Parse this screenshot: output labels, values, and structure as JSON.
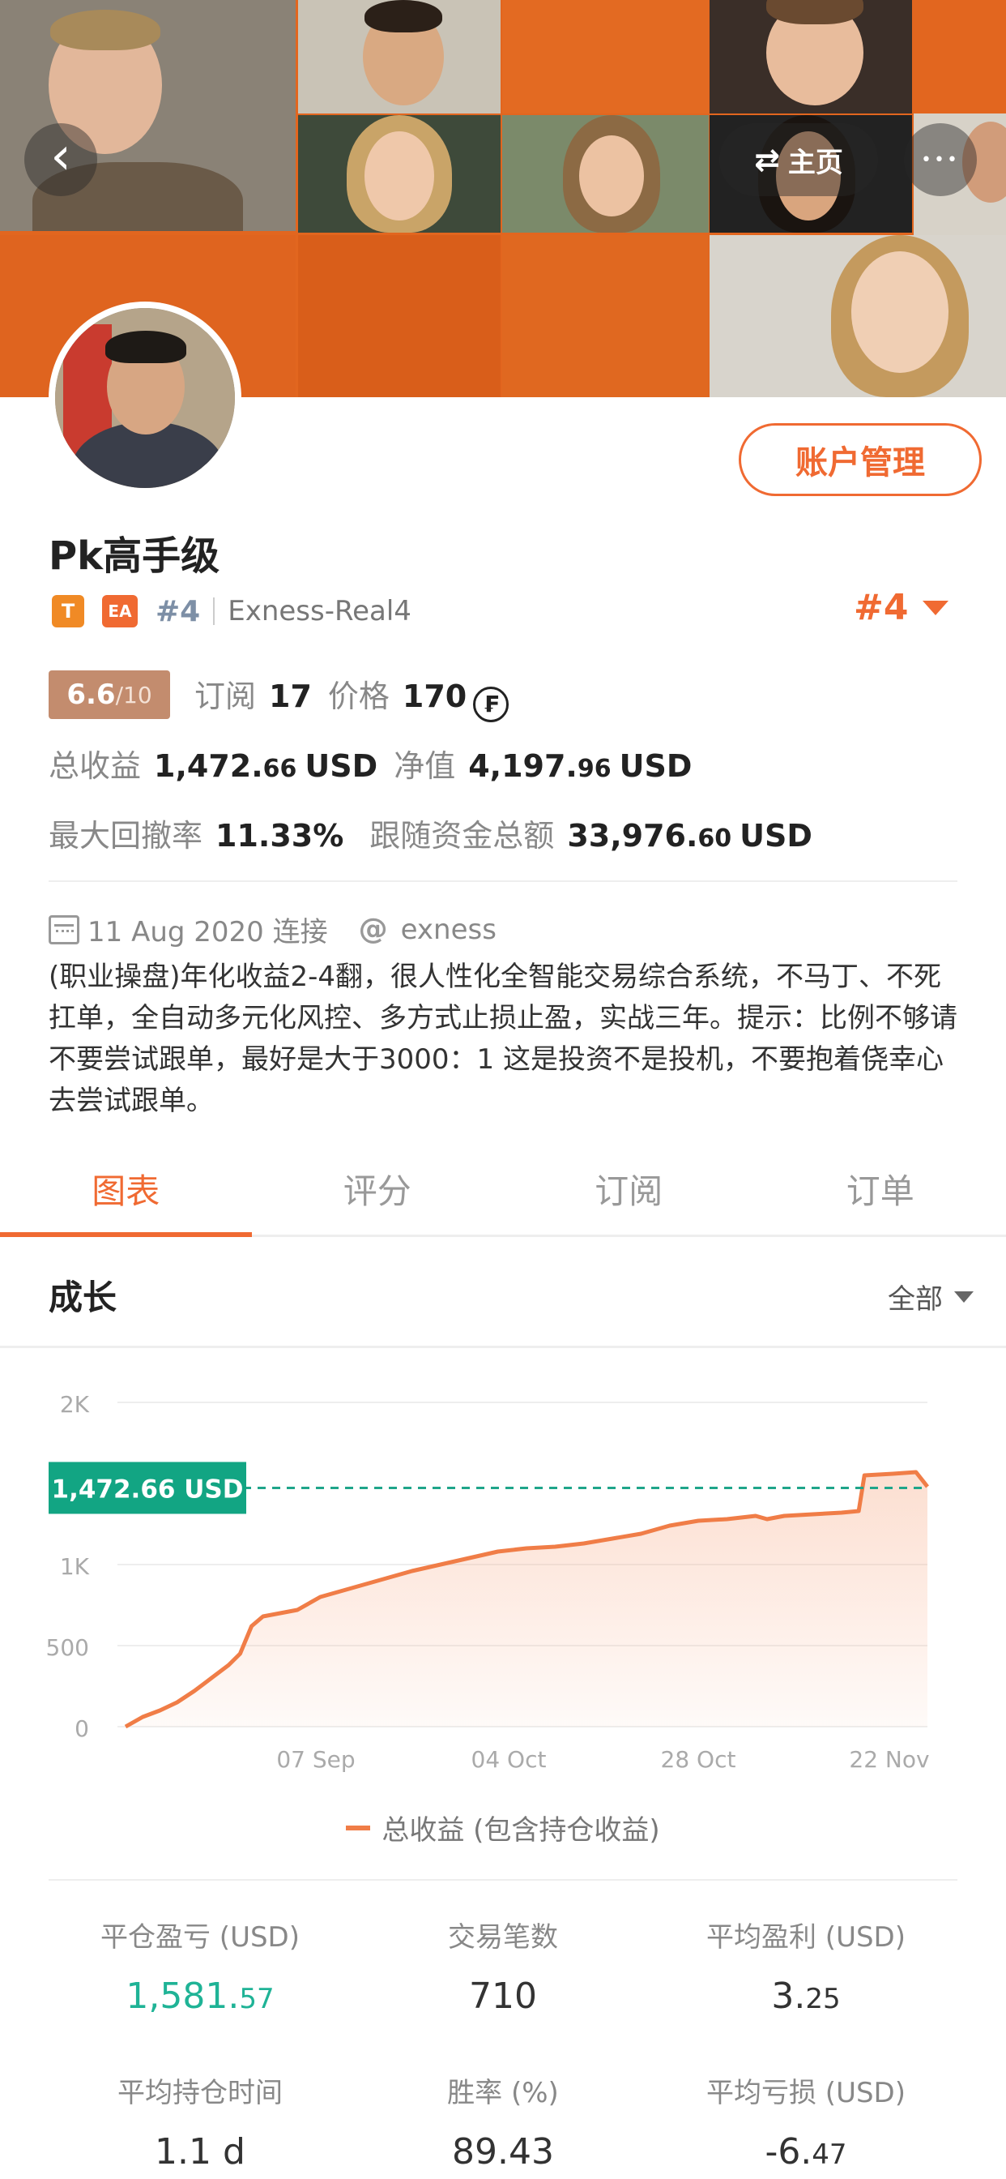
{
  "nav": {
    "home_label": "主页",
    "swap_icon": "⇄",
    "back_icon": "‹",
    "more_icon": "•••"
  },
  "profile": {
    "account_button": "账户管理",
    "name": "Pk高手级",
    "badge_t": "T",
    "badge_ea": "EA",
    "rank_small": "#4",
    "server": "Exness-Real4",
    "rank_big": "#4",
    "score": "6.6",
    "score_max": "/10",
    "subscribe_label": "订阅",
    "subscribe_count": "17",
    "price_label": "价格",
    "price_value": "170",
    "coin_symbol": "₣",
    "total_profit_label": "总收益",
    "total_profit_int": "1,472.",
    "total_profit_dec": "66",
    "total_profit_unit": "USD",
    "equity_label": "净值",
    "equity_int": "4,197.",
    "equity_dec": "96",
    "equity_unit": "USD",
    "drawdown_label": "最大回撤率",
    "drawdown_value": "11.33%",
    "follow_label": "跟随资金总额",
    "follow_int": "33,976.",
    "follow_dec": "60",
    "follow_unit": "USD",
    "date": "11 Aug 2020 连接",
    "broker": "exness",
    "description": "(职业操盘)年化收益2-4翻，很人性化全智能交易综合系统，不马丁、不死扛单，全自动多元化风控、多方式止损止盈，实战三年。提示：比例不够请不要尝试跟单，最好是大于3000：1 这是投资不是投机，不要抱着侥幸心去尝试跟单。"
  },
  "tabs": [
    "图表",
    "评分",
    "订阅",
    "订单"
  ],
  "growth": {
    "title": "成长",
    "filter": "全部"
  },
  "chart_data": {
    "type": "area",
    "series": [
      {
        "name": "总收益 (包含持仓收益)",
        "color": "#f07d47"
      }
    ],
    "current_label": "1,472.66 USD",
    "current_value": 1472.66,
    "y_ticks": [
      "2K",
      "1K",
      "500",
      "0"
    ],
    "x_ticks": [
      "07 Sep",
      "04 Oct",
      "28 Oct",
      "22 Nov"
    ],
    "ylim": [
      0,
      2000
    ],
    "points": [
      [
        0,
        0
      ],
      [
        3,
        60
      ],
      [
        6,
        100
      ],
      [
        9,
        150
      ],
      [
        12,
        220
      ],
      [
        15,
        300
      ],
      [
        18,
        380
      ],
      [
        20,
        450
      ],
      [
        22,
        620
      ],
      [
        24,
        680
      ],
      [
        27,
        700
      ],
      [
        30,
        720
      ],
      [
        34,
        800
      ],
      [
        38,
        840
      ],
      [
        42,
        880
      ],
      [
        46,
        920
      ],
      [
        50,
        960
      ],
      [
        55,
        1000
      ],
      [
        60,
        1040
      ],
      [
        65,
        1080
      ],
      [
        70,
        1100
      ],
      [
        75,
        1110
      ],
      [
        80,
        1130
      ],
      [
        85,
        1160
      ],
      [
        90,
        1190
      ],
      [
        95,
        1240
      ],
      [
        100,
        1270
      ],
      [
        105,
        1280
      ],
      [
        110,
        1300
      ],
      [
        112,
        1280
      ],
      [
        115,
        1300
      ],
      [
        120,
        1310
      ],
      [
        125,
        1320
      ],
      [
        128,
        1330
      ],
      [
        129,
        1550
      ],
      [
        134,
        1560
      ],
      [
        138,
        1570
      ],
      [
        140,
        1480
      ]
    ]
  },
  "stats": [
    {
      "title": "平仓盈亏 (USD)",
      "int": "1,581.",
      "dec": "57",
      "green": true
    },
    {
      "title": "交易笔数",
      "int": "710",
      "dec": "",
      "green": false
    },
    {
      "title": "平均盈利 (USD)",
      "int": "3.",
      "dec": "25",
      "green": false
    },
    {
      "title": "平均持仓时间",
      "int": "1.1 d",
      "dec": "",
      "green": false
    },
    {
      "title": "胜率 (%)",
      "int": "89.43",
      "dec": "",
      "green": false
    },
    {
      "title": "平均亏损 (USD)",
      "int": "-6.",
      "dec": "47",
      "green": false
    }
  ]
}
